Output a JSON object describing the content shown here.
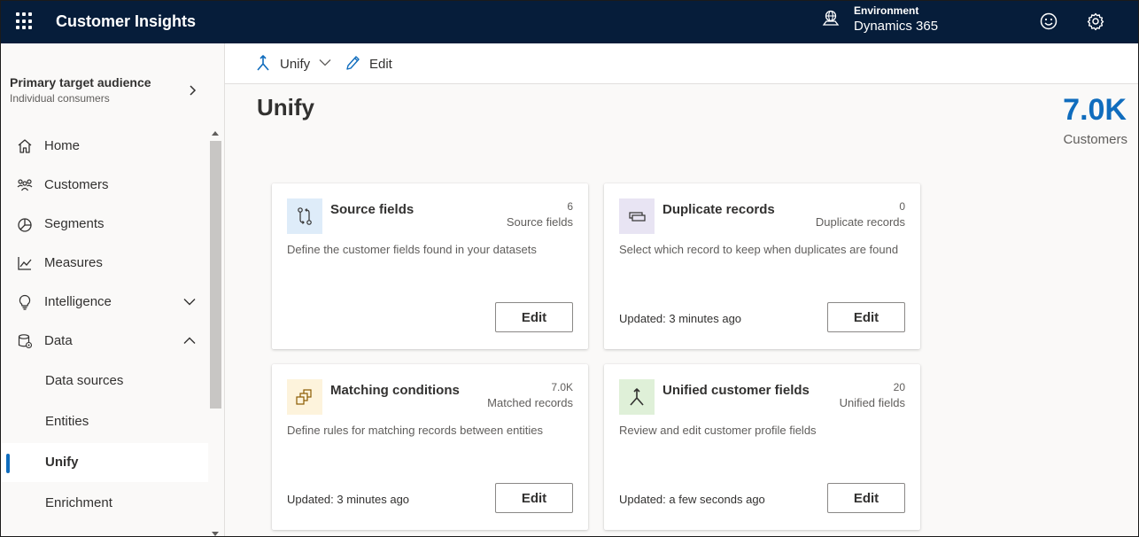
{
  "app": {
    "title": "Customer Insights"
  },
  "environment": {
    "label": "Environment",
    "value": "Dynamics 365"
  },
  "scope": {
    "title": "Primary target audience",
    "subtitle": "Individual consumers"
  },
  "nav": {
    "home": "Home",
    "customers": "Customers",
    "segments": "Segments",
    "measures": "Measures",
    "intelligence": "Intelligence",
    "data": "Data",
    "data_sources": "Data sources",
    "entities": "Entities",
    "unify": "Unify",
    "enrichment": "Enrichment"
  },
  "commands": {
    "unify": "Unify",
    "edit": "Edit"
  },
  "page": {
    "title": "Unify"
  },
  "kpi": {
    "value": "7.0K",
    "label": "Customers"
  },
  "cards": [
    {
      "title": "Source fields",
      "count": "6",
      "unit": "Source fields",
      "description": "Define the customer fields found in your datasets",
      "updated": "",
      "button": "Edit"
    },
    {
      "title": "Duplicate records",
      "count": "0",
      "unit": "Duplicate records",
      "description": "Select which record to keep when duplicates are found",
      "updated": "Updated: 3 minutes ago",
      "button": "Edit"
    },
    {
      "title": "Matching conditions",
      "count": "7.0K",
      "unit": "Matched records",
      "description": "Define rules for matching records between entities",
      "updated": "Updated: 3 minutes ago",
      "button": "Edit"
    },
    {
      "title": "Unified customer fields",
      "count": "20",
      "unit": "Unified fields",
      "description": "Review and edit customer profile fields",
      "updated": "Updated: a few seconds ago",
      "button": "Edit"
    }
  ],
  "colors": {
    "topbar": "#061d3a",
    "accent": "#0f6cbd",
    "kpi": "#0f6cbd"
  }
}
